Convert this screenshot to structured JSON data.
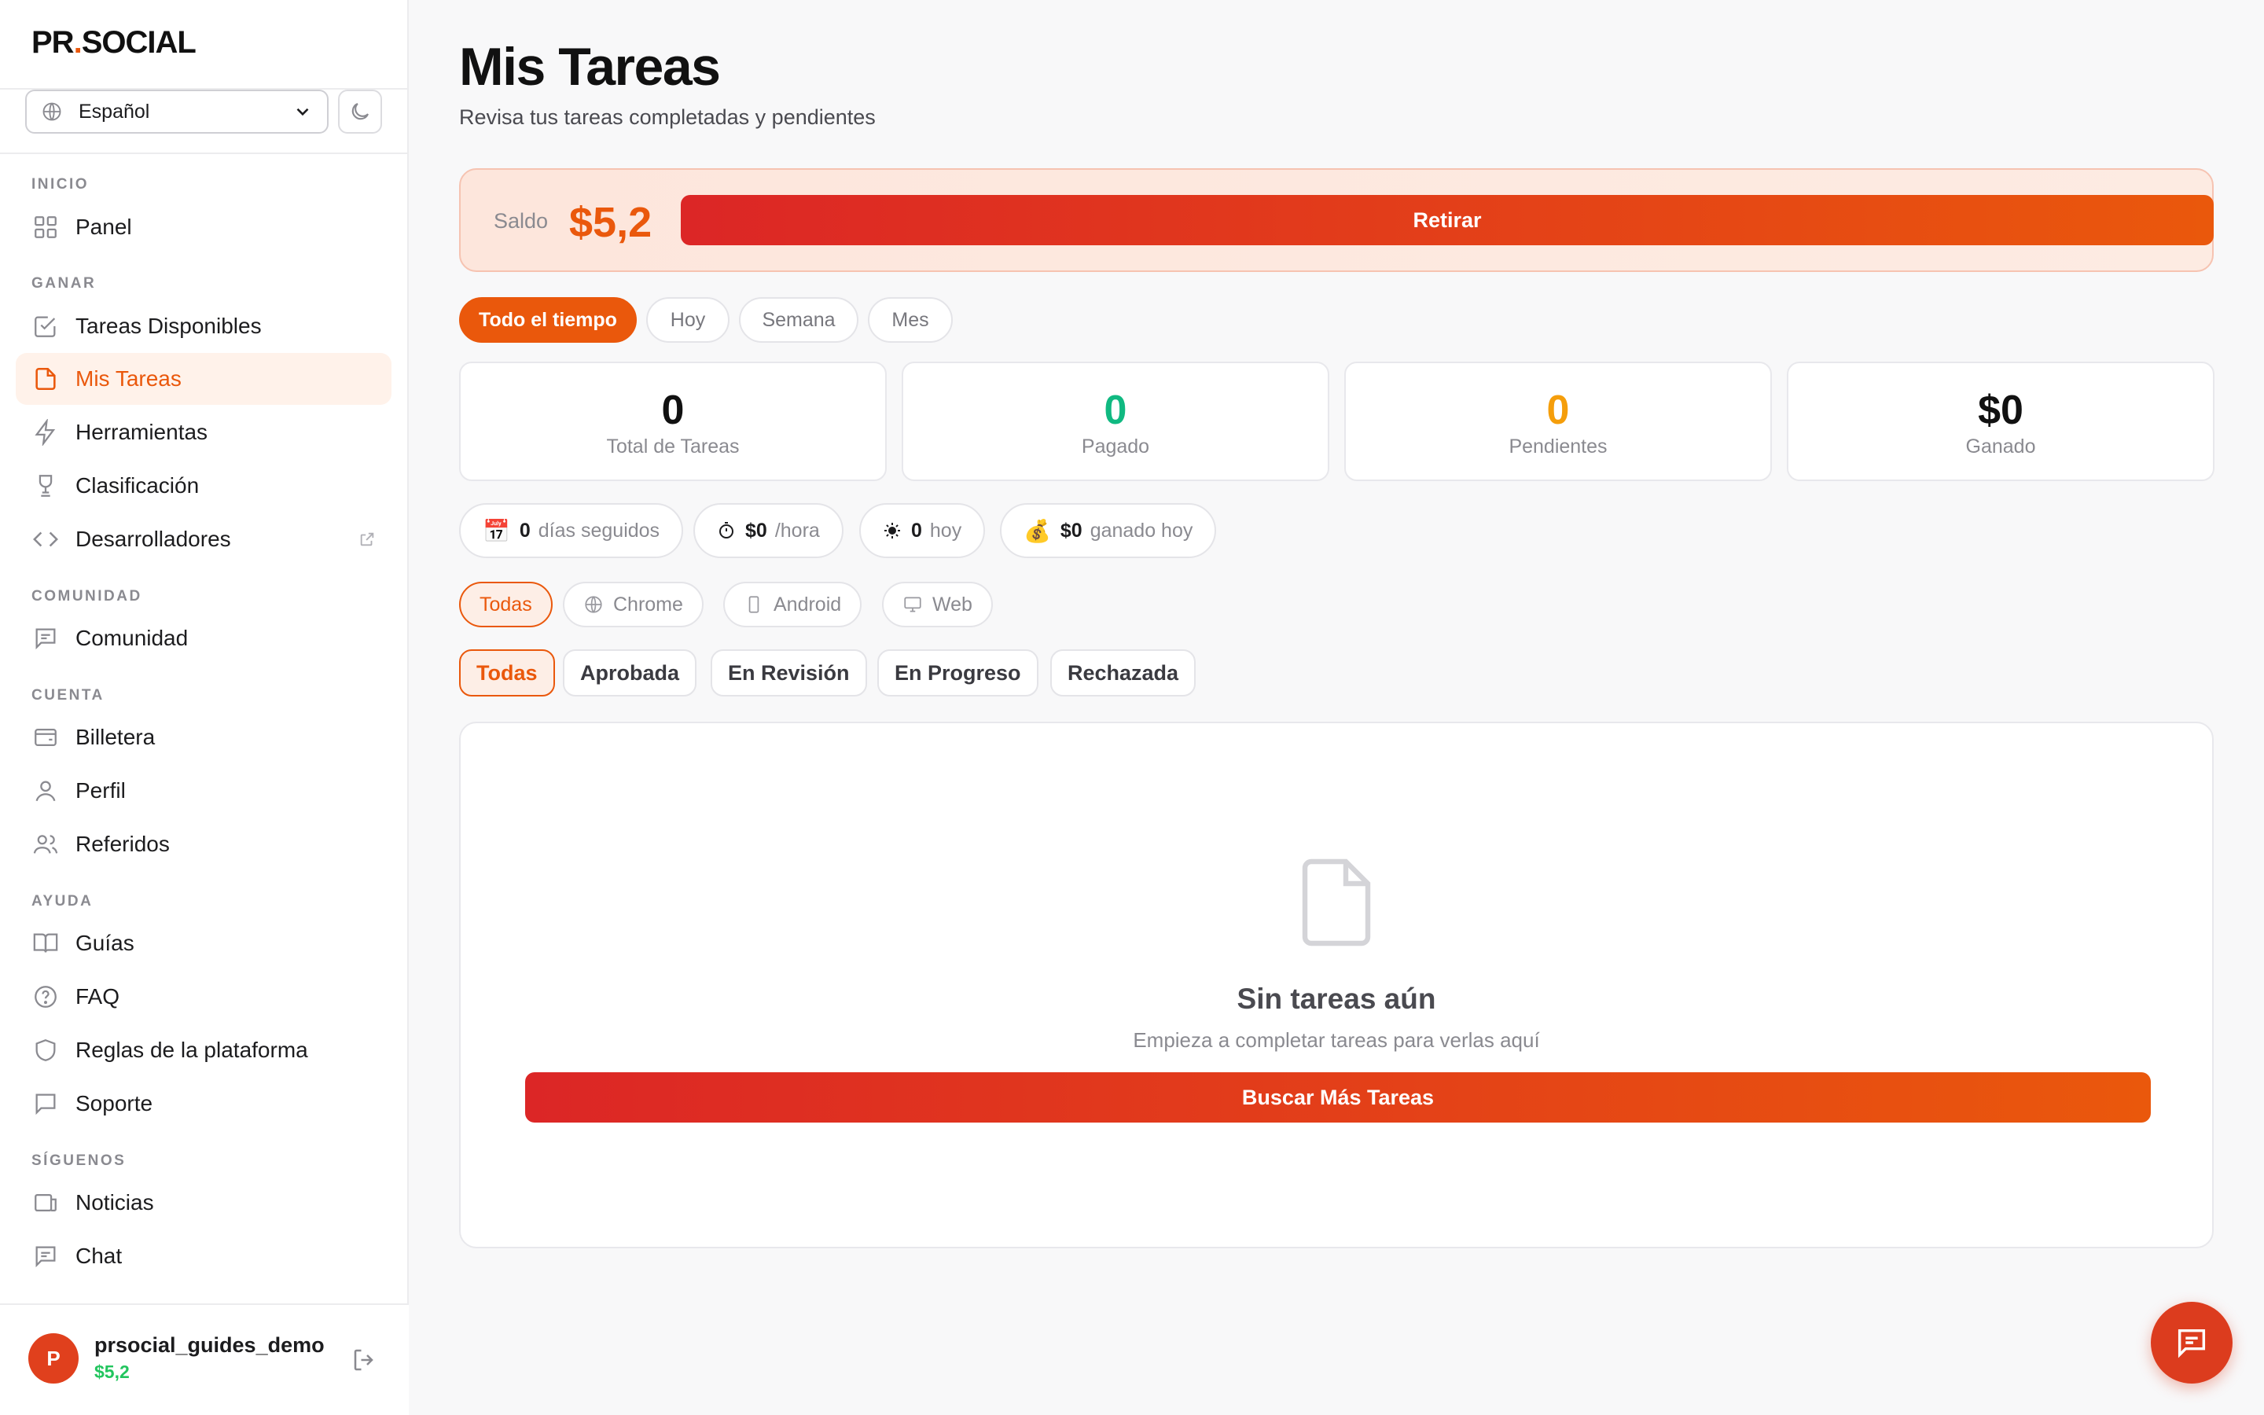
{
  "brand": {
    "logo_left": "PR",
    "logo_dot": ".",
    "logo_right": "SOCIAL",
    "accent": "#ea580c",
    "gradient_start": "#dc2626"
  },
  "sidebar": {
    "language": "Español",
    "sections": {
      "inicio": "INICIO",
      "ganar": "GANAR",
      "comunidad": "COMUNIDAD",
      "cuenta": "CUENTA",
      "ayuda": "AYUDA",
      "siguenos": "SÍGUENOS"
    },
    "items": {
      "panel": "Panel",
      "tareas_disponibles": "Tareas Disponibles",
      "mis_tareas": "Mis Tareas",
      "herramientas": "Herramientas",
      "clasificacion": "Clasificación",
      "desarrolladores": "Desarrolladores",
      "comunidad": "Comunidad",
      "billetera": "Billetera",
      "perfil": "Perfil",
      "referidos": "Referidos",
      "guias": "Guías",
      "faq": "FAQ",
      "reglas": "Reglas de la plataforma",
      "soporte": "Soporte",
      "noticias": "Noticias",
      "chat": "Chat"
    },
    "user": {
      "initial": "P",
      "name": "prsocial_guides_demo",
      "balance": "$5,2"
    }
  },
  "main": {
    "title": "Mis Tareas",
    "subtitle": "Revisa tus tareas completadas y pendientes",
    "balance": {
      "label": "Saldo",
      "value": "$5,2",
      "button": "Retirar"
    },
    "periods": [
      "Todo el tiempo",
      "Hoy",
      "Semana",
      "Mes"
    ],
    "stats": [
      {
        "value": "0",
        "label": "Total de Tareas",
        "color": "#111111"
      },
      {
        "value": "0",
        "label": "Pagado",
        "color": "#10b981"
      },
      {
        "value": "0",
        "label": "Pendientes",
        "color": "#f59e0b"
      },
      {
        "value": "$0",
        "label": "Ganado",
        "color": "#111111"
      }
    ],
    "chips": [
      {
        "icon": "calendar-icon",
        "strong": "0",
        "soft": "días seguidos"
      },
      {
        "icon": "stopwatch-icon",
        "strong": "$0",
        "soft": "/hora"
      },
      {
        "icon": "sun-icon",
        "strong": "0",
        "soft": "hoy"
      },
      {
        "icon": "money-bag-icon",
        "strong": "$0",
        "soft": "ganado hoy"
      }
    ],
    "platforms": [
      "Todas",
      "Chrome",
      "Android",
      "Web"
    ],
    "statuses": [
      "Todas",
      "Aprobada",
      "En Revisión",
      "En Progreso",
      "Rechazada"
    ],
    "empty": {
      "title": "Sin tareas aún",
      "subtitle": "Empieza a completar tareas para verlas aquí",
      "button": "Buscar Más Tareas"
    }
  }
}
